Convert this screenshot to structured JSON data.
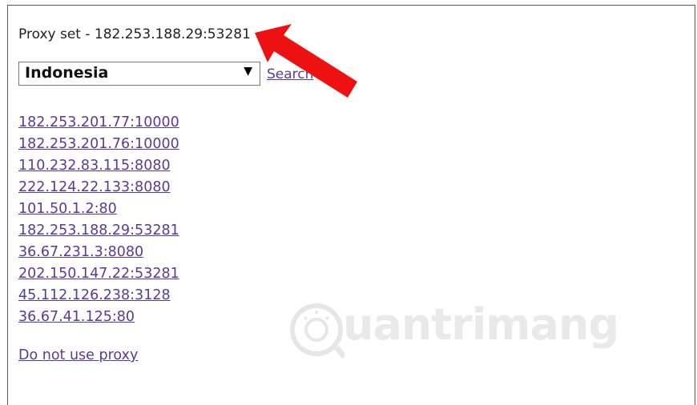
{
  "status": {
    "text": "Proxy set - 182.253.188.29:53281"
  },
  "country_select": {
    "selected": "Indonesia"
  },
  "search_link": {
    "label": "Search"
  },
  "proxies": [
    "182.253.201.77:10000",
    "182.253.201.76:10000",
    "110.232.83.115:8080",
    "222.124.22.133:8080",
    "101.50.1.2:80",
    "182.253.188.29:53281",
    "36.67.231.3:8080",
    "202.150.147.22:53281",
    "45.112.126.238:3128",
    "36.67.41.125:80"
  ],
  "no_proxy_link": {
    "label": "Do not use proxy"
  },
  "watermark": {
    "text": "uantrimang"
  },
  "colors": {
    "link": "#5a3a98",
    "arrow": "#ee1111"
  }
}
